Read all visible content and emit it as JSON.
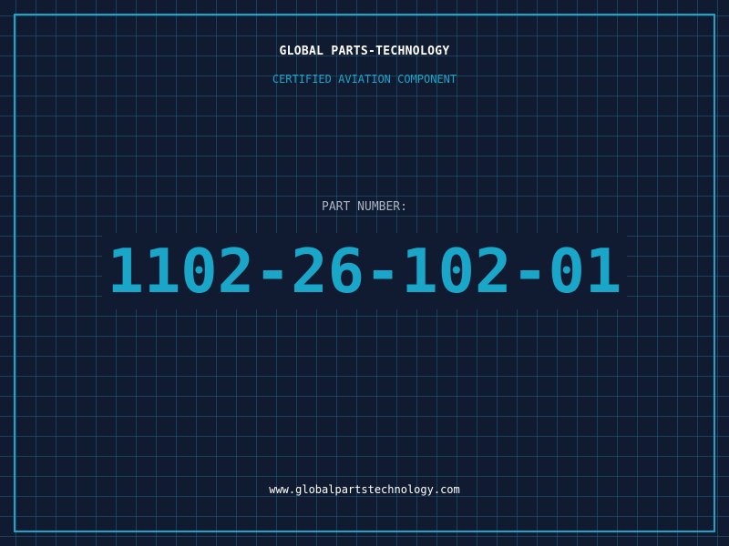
{
  "header": {
    "brand": "GLOBAL PARTS-TECHNOLOGY",
    "tagline": "CERTIFIED AVIATION COMPONENT"
  },
  "part": {
    "label": "PART NUMBER:",
    "number": "1102-26-102-01"
  },
  "footer": {
    "url": "www.globalpartstechnology.com"
  },
  "colors": {
    "background": "#101a30",
    "accent": "#1aa6c9",
    "grid": "#286e8c",
    "text_primary": "#ffffff",
    "text_muted": "#aab4c4"
  }
}
